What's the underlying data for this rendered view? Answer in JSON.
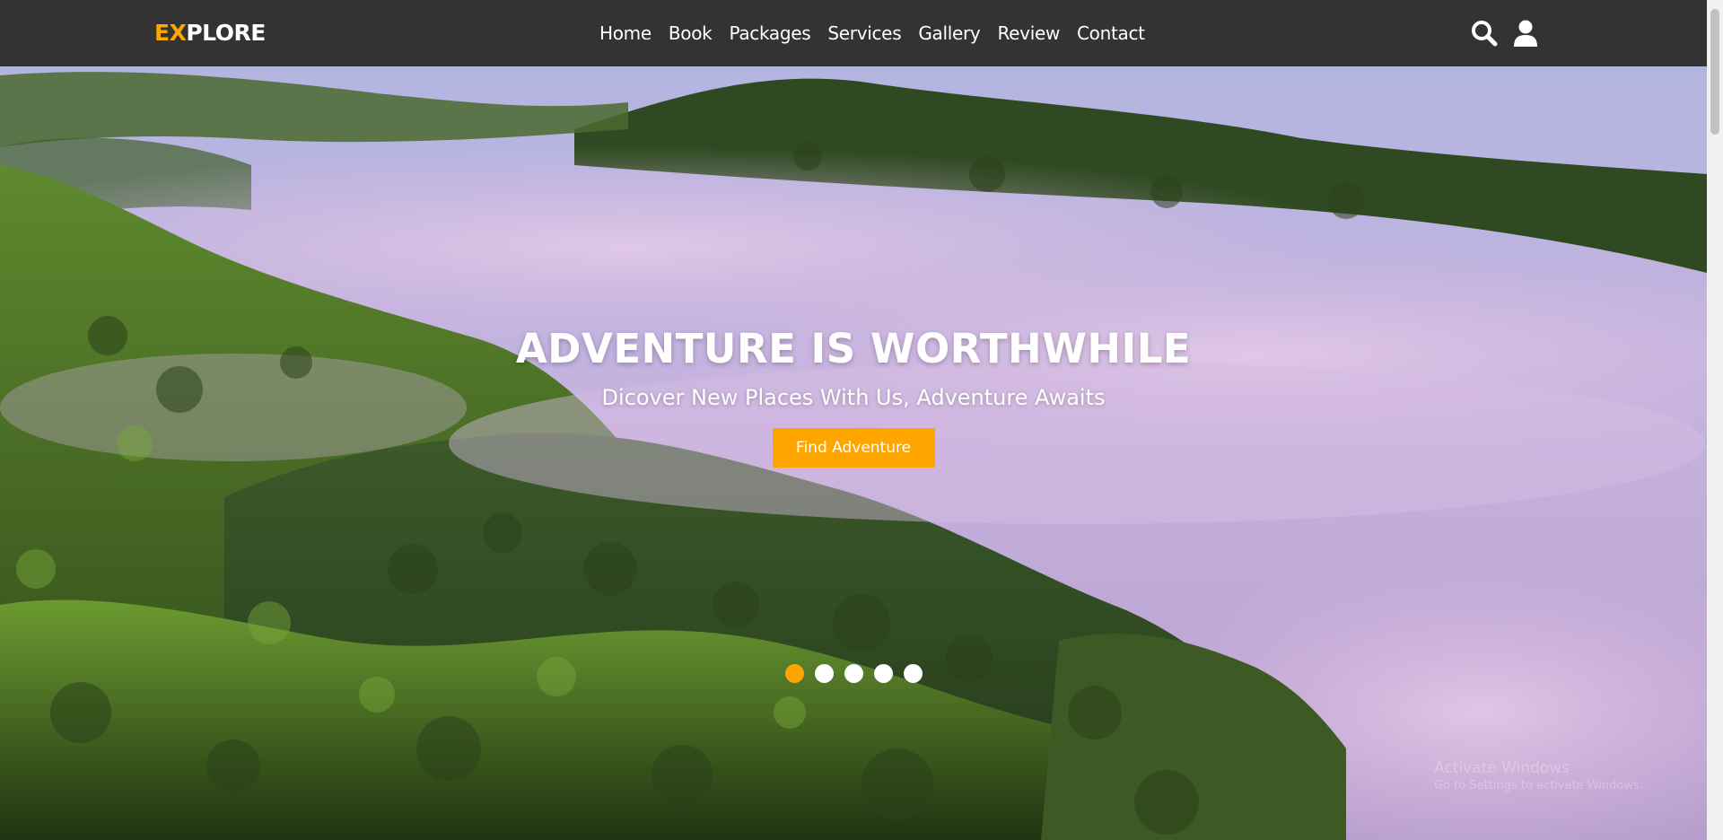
{
  "header": {
    "logo_accent": "EX",
    "logo_rest": "PLORE",
    "nav": [
      {
        "label": "Home"
      },
      {
        "label": "Book"
      },
      {
        "label": "Packages"
      },
      {
        "label": "Services"
      },
      {
        "label": "Gallery"
      },
      {
        "label": "Review"
      },
      {
        "label": "Contact"
      }
    ],
    "icons": [
      "search-icon",
      "user-icon"
    ]
  },
  "hero": {
    "title": "ADVENTURE IS WORTHWHILE",
    "subtitle": "Dicover New Places With Us, Adventure Awaits",
    "cta_label": "Find Adventure",
    "slide_count": 5,
    "active_slide": 1
  },
  "watermark": {
    "line1": "Activate Windows",
    "line2": "Go to Settings to activate Windows."
  },
  "colors": {
    "accent": "#ffa500",
    "header_bg": "#333333",
    "text": "#ffffff"
  }
}
